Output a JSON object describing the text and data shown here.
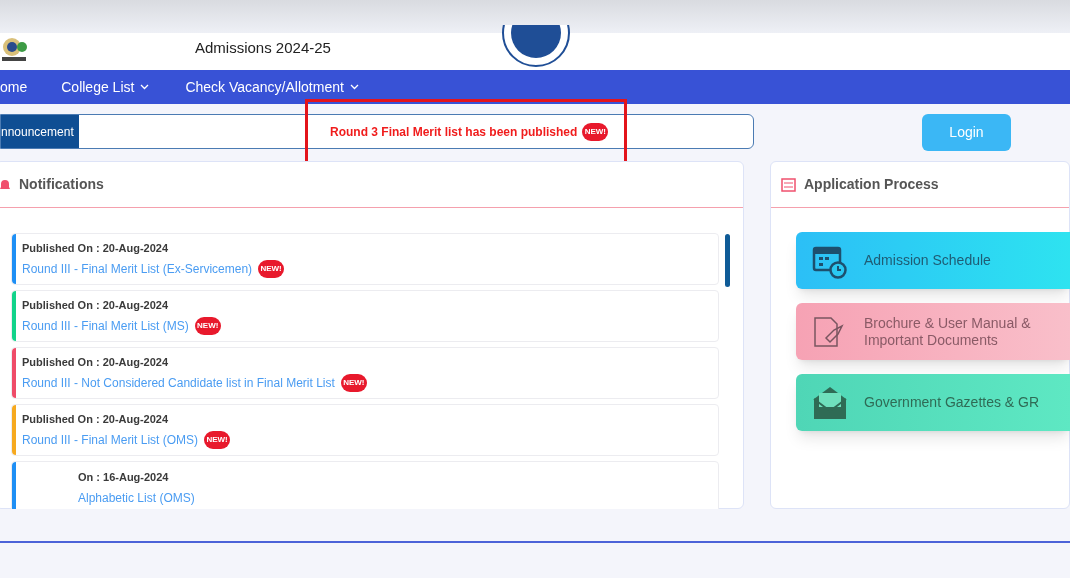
{
  "header": {
    "subtitle": "Admissions 2024-25"
  },
  "nav": [
    {
      "label": "ome",
      "dropdown": false
    },
    {
      "label": "College List",
      "dropdown": true
    },
    {
      "label": "Check Vacancy/Allotment",
      "dropdown": true
    }
  ],
  "announcement": {
    "label": "nnouncement",
    "message": "Round 3 Final Merit list has been published",
    "badge": "NEW!"
  },
  "login_button": "Login",
  "notifications": {
    "title": "Notifications",
    "items": [
      {
        "published": "Published On : 20-Aug-2024",
        "title": "Round III - Final Merit List (Ex-Servicemen)",
        "badge": "NEW!",
        "color": "#1e8ff5"
      },
      {
        "published": "Published On : 20-Aug-2024",
        "title": "Round III - Final Merit List (MS)",
        "badge": "NEW!",
        "color": "#12d38a"
      },
      {
        "published": "Published On : 20-Aug-2024",
        "title": "Round III - Not Considered Candidate list in Final Merit List",
        "badge": "NEW!",
        "color": "#ef4b68"
      },
      {
        "published": "Published On : 20-Aug-2024",
        "title": "Round III - Final Merit List (OMS)",
        "badge": "NEW!",
        "color": "#f6a91f"
      },
      {
        "published": "On : 16-Aug-2024",
        "title": "Alphabetic List (OMS)",
        "color": "#1e8ff5"
      }
    ]
  },
  "application_process": {
    "title": "Application Process",
    "tiles": [
      {
        "kind": "schedule",
        "label": "Admission Schedule"
      },
      {
        "kind": "brochure",
        "label": "Brochure & User Manual & Important Documents"
      },
      {
        "kind": "gazette",
        "label": "Government Gazettes & GR"
      }
    ]
  }
}
